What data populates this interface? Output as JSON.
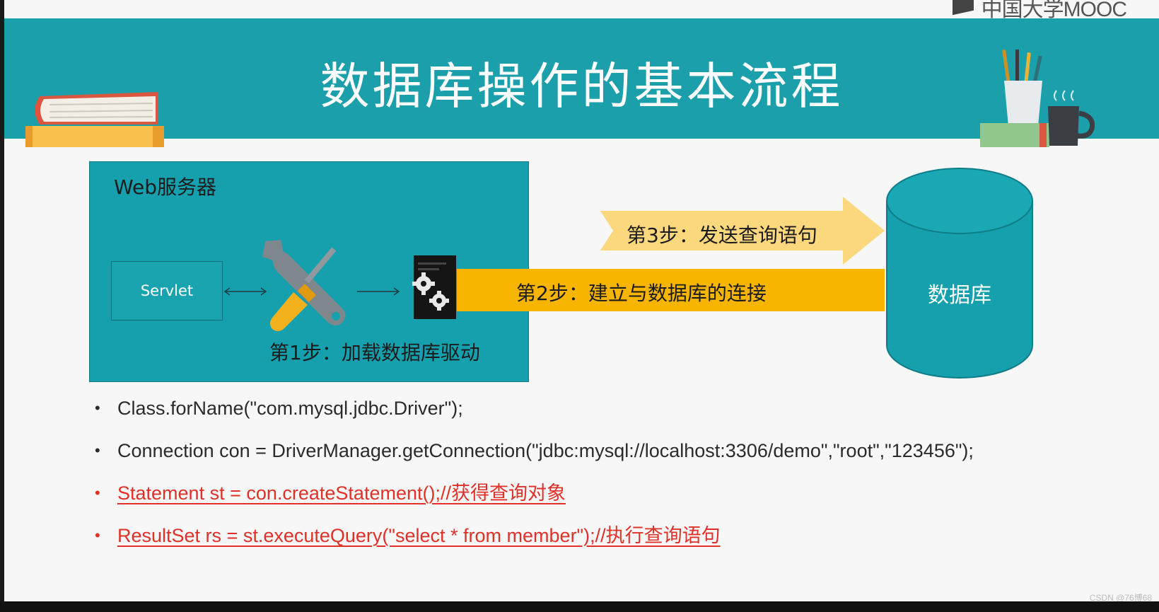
{
  "slide": {
    "title": "数据库操作的基本流程",
    "watermark": "中国大学MOOC",
    "corner_mark": "CSDN @76博68"
  },
  "diagram": {
    "web_server_label": "Web服务器",
    "servlet_label": "Servlet",
    "step1": "第1步：加载数据库驱动",
    "step2": "第2步：建立与数据库的连接",
    "step3": "第3步：发送查询语句",
    "database_label": "数据库"
  },
  "code_lines": [
    "Class.forName(\"com.mysql.jdbc.Driver\");",
    "Connection con = DriverManager.getConnection(\"jdbc:mysql://localhost:3306/demo\",\"root\",\"123456\");",
    "Statement st = con.createStatement();//获得查询对象",
    "ResultSet rs = st.executeQuery(\"select * from member\");//执行查询语句"
  ],
  "colors": {
    "banner": "#1a9fab",
    "highlight_text": "#e03128",
    "connection_band": "#f7b500",
    "query_arrow": "#fbd87d"
  },
  "icons": [
    "tools-icon",
    "gear-icon",
    "database-icon",
    "books-icon",
    "pencil-cup-icon",
    "coffee-mug-icon"
  ]
}
